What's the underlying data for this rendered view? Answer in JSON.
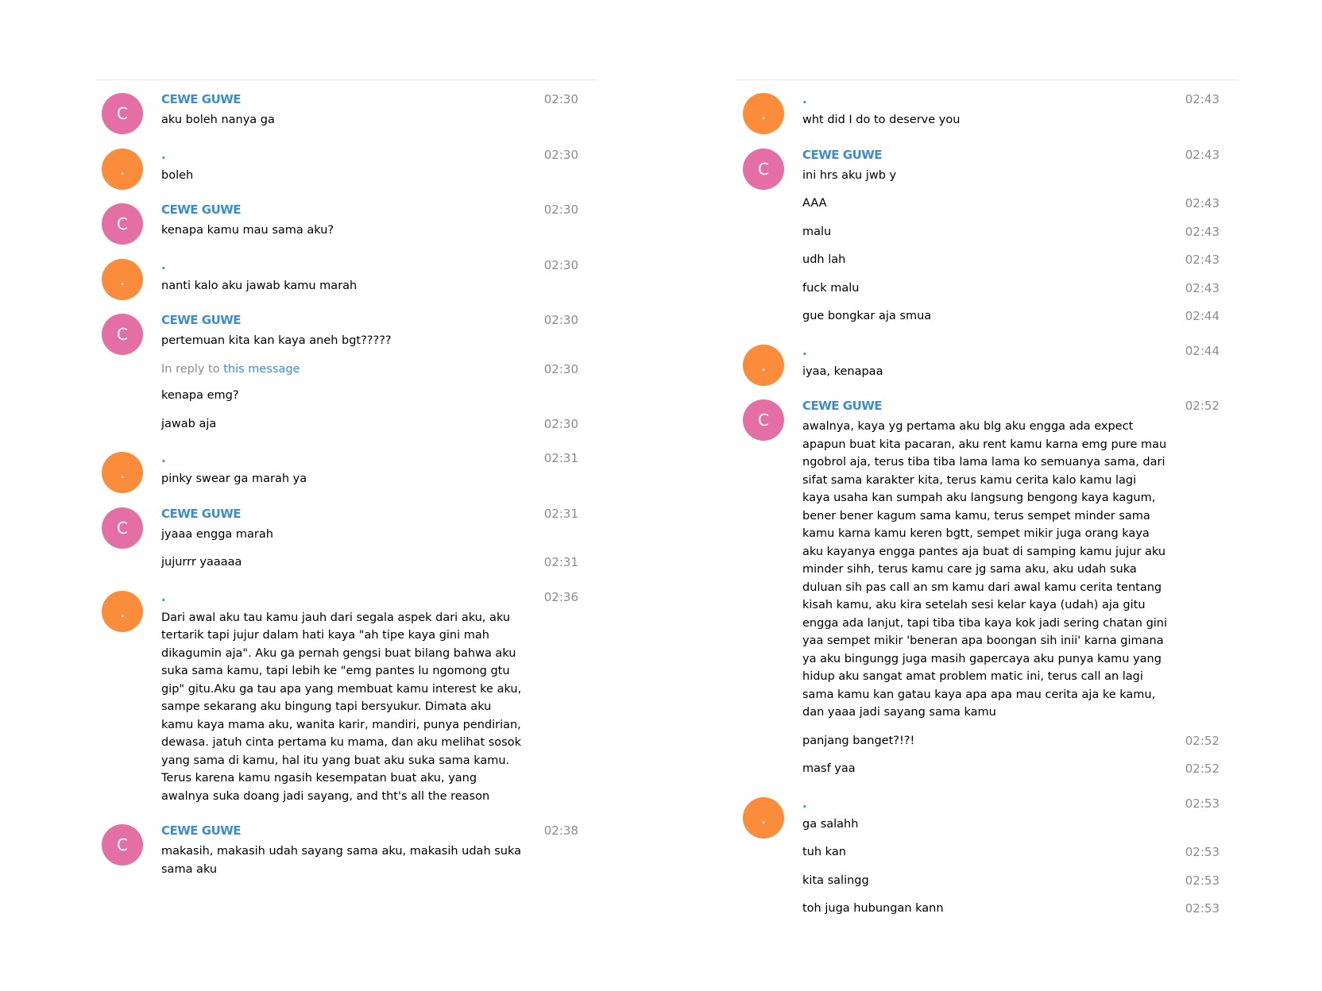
{
  "left": {
    "groups": [
      {
        "sender": "CEWE GUWE",
        "avatar": "C",
        "color": "pink",
        "time": "02:30",
        "messages": [
          {
            "text": "aku boleh nanya ga"
          }
        ]
      },
      {
        "sender": ".",
        "avatar": ".",
        "color": "orange",
        "time": "02:30",
        "messages": [
          {
            "text": "boleh"
          }
        ]
      },
      {
        "sender": "CEWE GUWE",
        "avatar": "C",
        "color": "pink",
        "time": "02:30",
        "messages": [
          {
            "text": "kenapa kamu mau sama aku?"
          }
        ]
      },
      {
        "sender": ".",
        "avatar": ".",
        "color": "orange",
        "time": "02:30",
        "messages": [
          {
            "text": "nanti kalo aku jawab kamu marah"
          }
        ]
      },
      {
        "sender": "CEWE GUWE",
        "avatar": "C",
        "color": "pink",
        "time": "02:30",
        "messages": [
          {
            "text": "pertemuan kita kan kaya aneh bgt?????"
          },
          {
            "reply_label": "In reply to",
            "reply_link": "this message",
            "text": "kenapa emg?",
            "time": "02:30"
          },
          {
            "text": "jawab aja",
            "time": "02:30"
          }
        ]
      },
      {
        "sender": ".",
        "avatar": ".",
        "color": "orange",
        "time": "02:31",
        "messages": [
          {
            "text": "pinky swear ga marah ya"
          }
        ]
      },
      {
        "sender": "CEWE GUWE",
        "avatar": "C",
        "color": "pink",
        "time": "02:31",
        "messages": [
          {
            "text": "jyaaa engga marah"
          },
          {
            "text": "jujurrr yaaaaa",
            "time": "02:31"
          }
        ]
      },
      {
        "sender": ".",
        "avatar": ".",
        "color": "orange",
        "time": "02:36",
        "messages": [
          {
            "text": "Dari awal aku tau kamu jauh dari segala aspek dari aku, aku tertarik tapi jujur dalam hati kaya \"ah tipe kaya gini mah dikagumin aja\". Aku ga pernah gengsi buat bilang bahwa aku suka sama kamu, tapi lebih ke \"emg pantes lu ngomong gtu gip\" gitu.Aku ga tau apa yang membuat kamu interest ke aku, sampe sekarang aku bingung tapi bersyukur. Dimata aku kamu kaya mama aku, wanita karir, mandiri, punya pendirian, dewasa. jatuh cinta pertama ku mama, dan aku melihat sosok yang sama di kamu, hal itu yang buat aku suka sama kamu. Terus karena kamu ngasih kesempatan buat aku, yang awalnya suka doang jadi sayang, and tht's all the reason"
          }
        ]
      },
      {
        "sender": "CEWE GUWE",
        "avatar": "C",
        "color": "pink",
        "time": "02:38",
        "messages": [
          {
            "text": "makasih, makasih udah sayang sama aku, makasih udah suka sama aku"
          }
        ]
      }
    ]
  },
  "right": {
    "groups": [
      {
        "sender": ".",
        "avatar": ".",
        "color": "orange",
        "time": "02:43",
        "messages": [
          {
            "text": "wht did I do to deserve you"
          }
        ]
      },
      {
        "sender": "CEWE GUWE",
        "avatar": "C",
        "color": "pink",
        "time": "02:43",
        "messages": [
          {
            "text": "ini hrs aku jwb y"
          },
          {
            "text": "AAA",
            "time": "02:43"
          },
          {
            "text": "malu",
            "time": "02:43"
          },
          {
            "text": "udh lah",
            "time": "02:43"
          },
          {
            "text": "fuck malu",
            "time": "02:43"
          },
          {
            "text": "gue bongkar aja smua",
            "time": "02:44"
          }
        ]
      },
      {
        "sender": ".",
        "avatar": ".",
        "color": "orange",
        "time": "02:44",
        "messages": [
          {
            "text": "iyaa, kenapaa"
          }
        ]
      },
      {
        "sender": "CEWE GUWE",
        "avatar": "C",
        "color": "pink",
        "time": "02:52",
        "messages": [
          {
            "text": "awalnya, kaya yg pertama aku blg aku engga ada expect apapun buat kita pacaran, aku rent kamu karna emg pure mau ngobrol aja, terus tiba tiba lama lama ko semuanya sama, dari sifat sama karakter kita, terus kamu cerita kalo kamu lagi kaya usaha kan sumpah aku langsung bengong kaya kagum, bener bener kagum sama kamu, terus sempet minder sama kamu karna kamu keren bgtt, sempet mikir juga orang kaya aku kayanya engga pantes aja buat di samping kamu jujur aku minder sihh, terus kamu care jg sama aku, aku udah suka duluan sih pas call an sm kamu dari awal kamu cerita tentang kisah kamu, aku kira setelah sesi kelar kaya (udah) aja gitu engga ada lanjut, tapi tiba tiba kaya kok jadi sering chatan gini yaa sempet mikir 'beneran apa boongan sih inii' karna gimana ya aku bingungg juga masih gapercaya aku punya kamu yang hidup aku sangat amat problem matic ini, terus call an lagi sama kamu kan gatau kaya apa apa mau cerita aja ke kamu, dan yaaa jadi sayang sama kamu"
          },
          {
            "text": "panjang banget?!?!",
            "time": "02:52"
          },
          {
            "text": "masf yaa",
            "time": "02:52"
          }
        ]
      },
      {
        "sender": ".",
        "avatar": ".",
        "color": "orange",
        "time": "02:53",
        "messages": [
          {
            "text": "ga salahh"
          },
          {
            "text": "tuh kan",
            "time": "02:53"
          },
          {
            "text": "kita salingg",
            "time": "02:53"
          },
          {
            "text": "toh juga hubungan kann",
            "time": "02:53"
          }
        ]
      }
    ]
  }
}
